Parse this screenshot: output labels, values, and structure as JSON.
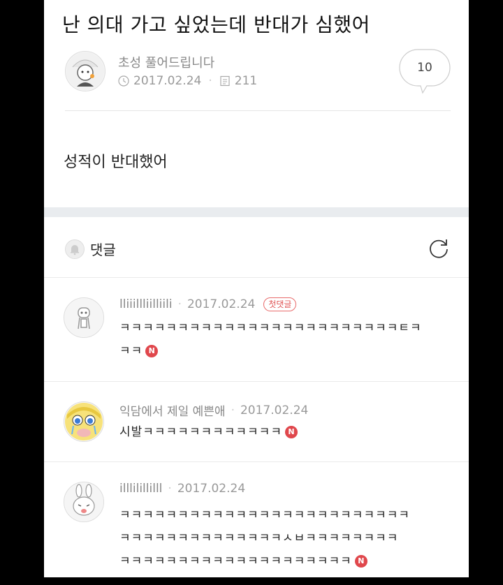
{
  "post": {
    "title": "난 의대 가고 싶었는데 반대가 심했어",
    "author": "초성 풀어드립니다",
    "date": "2017.02.24",
    "views": "211",
    "comment_count": "10",
    "body": "성적이 반대했어"
  },
  "comments_section": {
    "label": "댓글"
  },
  "comments": [
    {
      "nick": "lliiillliilliili",
      "date": "2017.02.24",
      "badge": "첫댓글",
      "line1": "ㅋㅋㅋㅋㅋㅋㅋㅋㅋㅋㅋㅋㅋㅋㅋㅋㅋㅋㅋㅋㅋㅋㅋㅋㅌㅋ",
      "line2": "ㅋㅋ",
      "new_badge": "N"
    },
    {
      "nick": "익담에서 제일 예쁜애",
      "date": "2017.02.24",
      "line1": "시발ㅋㅋㅋㅋㅋㅋㅋㅋㅋㅋㅋㅋ",
      "new_badge": "N"
    },
    {
      "nick": "illlilillilll",
      "date": "2017.02.24",
      "line1": "ㅋㅋㅋㅋㅋㅋㅋㅋㅋㅋㅋㅋㅋㅋㅋㅋㅋㅋㅋㅋㅋㅋㅋㅋㅋ",
      "line2": "ㅋㅋㅋㅋㅋㅋㅋㅋㅋㅋㅋㅋㅋㅋㅅㅂㅋㅋㅋㅋㅋㅋㅋㅋ",
      "line3": "ㅋㅋㅋㅋㅋㅋㅋㅋㅋㅋㅋㅋㅋㅋㅋㅋㅋㅋㅋㅋ",
      "new_badge": "N"
    }
  ]
}
